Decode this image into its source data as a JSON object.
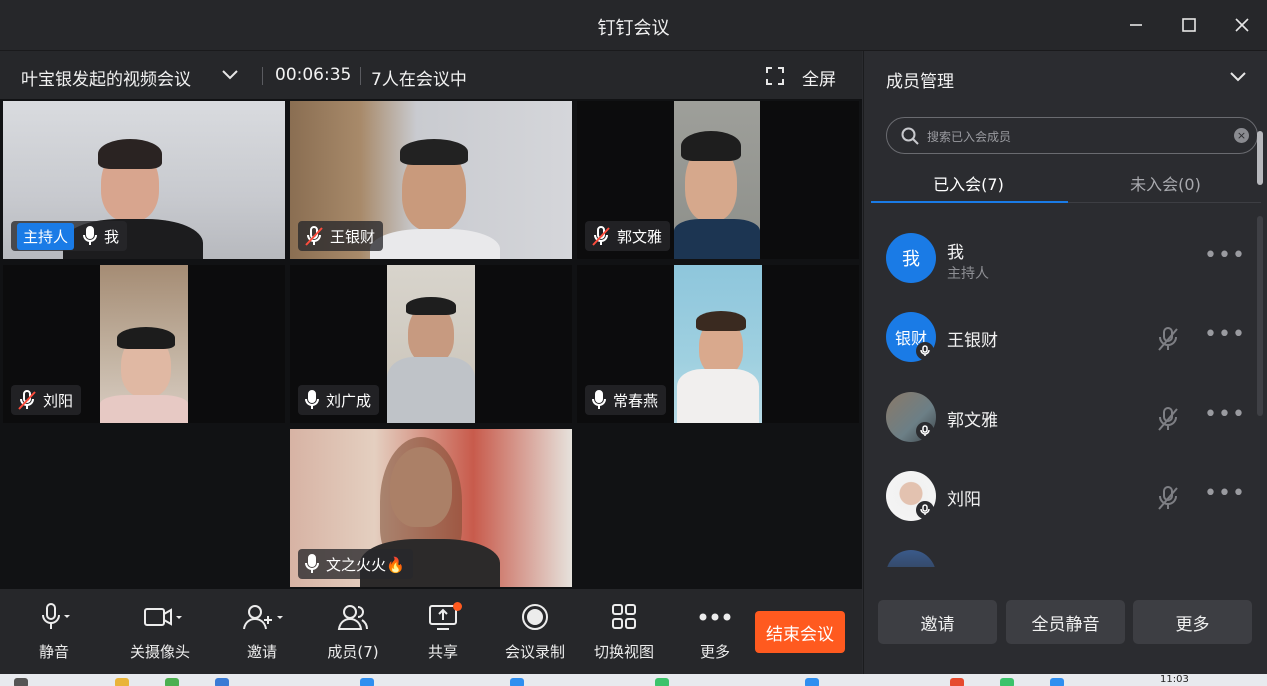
{
  "window": {
    "title": "钉钉会议"
  },
  "meeting": {
    "title": "叶宝银发起的视频会议",
    "duration": "00:06:35",
    "participants_summary": "7人在会议中",
    "fullscreen_label": "全屏"
  },
  "tiles": [
    {
      "name": "我",
      "host_label": "主持人",
      "muted": false
    },
    {
      "name": "王银财",
      "muted": true
    },
    {
      "name": "郭文雅",
      "muted": true
    },
    {
      "name": "刘阳",
      "muted": true
    },
    {
      "name": "刘广成",
      "muted": false
    },
    {
      "name": "常春燕",
      "muted": false
    },
    {
      "name": "文之火火🔥",
      "muted": false
    }
  ],
  "toolbar": {
    "mute": "静音",
    "camera_off": "关摄像头",
    "invite": "邀请",
    "members": "成员(7)",
    "share": "共享",
    "record": "会议录制",
    "switch_view": "切换视图",
    "more": "更多",
    "end": "结束会议"
  },
  "panel": {
    "title": "成员管理",
    "search_placeholder": "搜索已入会成员",
    "tab_joined": "已入会(7)",
    "tab_not_joined": "未入会(0)",
    "members": [
      {
        "avatar_text": "我",
        "name": "我",
        "role": "主持人",
        "muted": false
      },
      {
        "avatar_text": "银财",
        "name": "王银财",
        "role": "",
        "muted": true
      },
      {
        "avatar_text": "",
        "name": "郭文雅",
        "role": "",
        "muted": true
      },
      {
        "avatar_text": "",
        "name": "刘阳",
        "role": "",
        "muted": true
      }
    ],
    "btn_invite": "邀请",
    "btn_mute_all": "全员静音",
    "btn_more": "更多"
  },
  "taskbar": {
    "time": "11:03"
  },
  "colors": {
    "accent": "#1a7be6",
    "end_button": "#ff5a1f"
  }
}
